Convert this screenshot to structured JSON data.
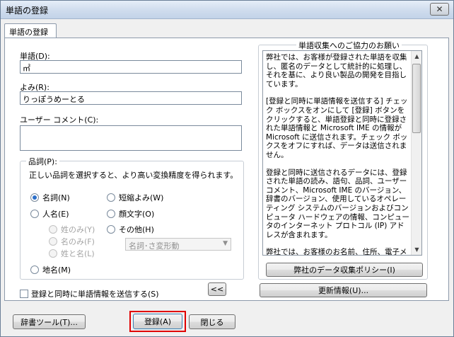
{
  "window": {
    "title": "単語の登録",
    "close_glyph": "✕"
  },
  "tab": {
    "label": "単語の登録"
  },
  "form": {
    "word_label": "単語(D):",
    "word_value": "㎡",
    "reading_label": "よみ(R):",
    "reading_value": "りっぽうめーとる",
    "comment_label": "ユーザー コメント(C):",
    "comment_value": ""
  },
  "pos": {
    "group_label": "品詞(P):",
    "hint": "正しい品詞を選択すると、より高い変換精度を得られます。",
    "noun": "名詞(N)",
    "short_reading": "短縮よみ(W)",
    "person_name": "人名(E)",
    "emoticon": "顔文字(O)",
    "surname_only": "姓のみ(Y)",
    "given_only": "名のみ(F)",
    "surname_and_given": "姓と名(L)",
    "other": "その他(H)",
    "other_select_value": "名詞･さ変形動",
    "place_name": "地名(M)"
  },
  "send_checkbox_label": "登録と同時に単語情報を送信する(S)",
  "collapse_button": "<<",
  "info_panel": {
    "title": "単語収集へのご協力のお願い",
    "paragraphs": [
      "弊社では、お客様が登録された単語を収集し、匿名のデータとして統計的に処理し、それを基に、より良い製品の開発を目指しています。",
      "[登録と同時に単語情報を送信する] チェック ボックスをオンにして [登録] ボタンをクリックすると、単語登録と同時に登録された単語情報と Microsoft IME の情報が Microsoft に送信されます。チェック ボックスをオフにすれば、データは送信されません。",
      "登録と同時に送信されるデータには、登録された単語の読み、語句、品詞、ユーザー コメント、Microsoft IME のバージョン、辞書のバージョン、使用しているオペレーティング システムのバージョンおよびコンピュータ ハードウェアの情報、コンピュータのインターネット プロトコル (IP) アドレスが含まれます。",
      "弊社では、お客様のお名前、住所、電子メール アドレスなど個人を特定できるいかなる形態の情報も意図的に収集することはありません。"
    ],
    "policy_button": "弊社のデータ収集ポリシー(I)",
    "update_button": "更新情報(U)..."
  },
  "footer": {
    "dict_tool_button": "辞書ツール(T)...",
    "register_button": "登録(A)",
    "close_button": "閉じる"
  },
  "colors": {
    "highlight": "#e00000",
    "radio_selected": "#2c6fc9"
  }
}
